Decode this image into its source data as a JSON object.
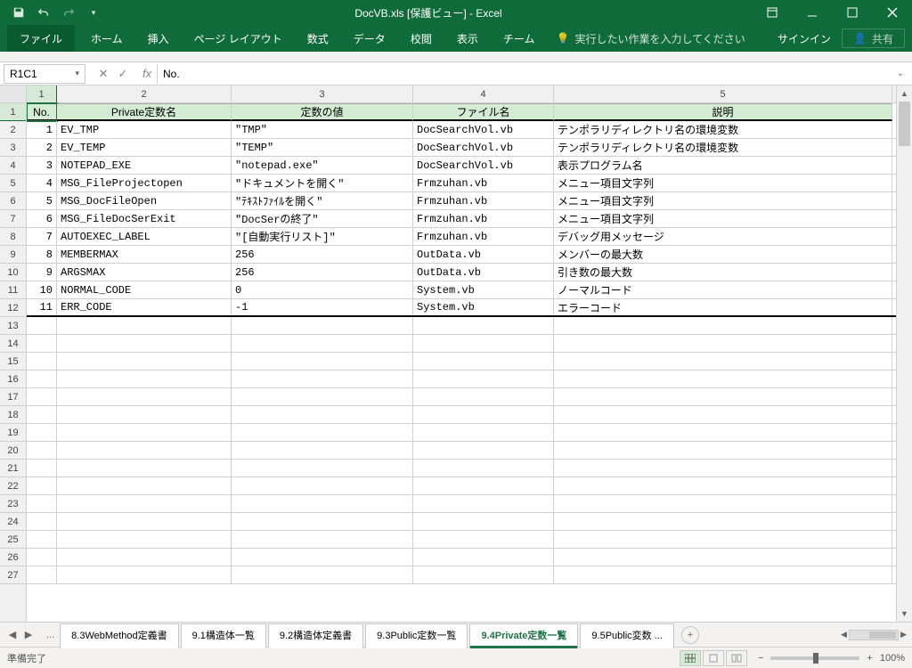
{
  "title": "DocVB.xls  [保護ビュー] - Excel",
  "qat": {
    "save": "save",
    "undo": "undo",
    "redo": "redo"
  },
  "ribbon": {
    "file": "ファイル",
    "tabs": [
      "ホーム",
      "挿入",
      "ページ レイアウト",
      "数式",
      "データ",
      "校閲",
      "表示",
      "チーム"
    ],
    "tell_me": "実行したい作業を入力してください",
    "signin": "サインイン",
    "share": "共有"
  },
  "fx": {
    "namebox": "R1C1",
    "formula": "No."
  },
  "columns": [
    "1",
    "2",
    "3",
    "4",
    "5"
  ],
  "header_row": [
    "No.",
    "Private定数名",
    "定数の値",
    "ファイル名",
    "説明"
  ],
  "rows": [
    {
      "no": "1",
      "name": "EV_TMP",
      "val": "\"TMP\"",
      "file": "DocSearchVol.vb",
      "desc": "テンポラリディレクトリ名の環境変数"
    },
    {
      "no": "2",
      "name": "EV_TEMP",
      "val": "\"TEMP\"",
      "file": "DocSearchVol.vb",
      "desc": "テンポラリディレクトリ名の環境変数"
    },
    {
      "no": "3",
      "name": "NOTEPAD_EXE",
      "val": "\"notepad.exe\"",
      "file": "DocSearchVol.vb",
      "desc": "表示プログラム名"
    },
    {
      "no": "4",
      "name": "MSG_FileProjectopen",
      "val": "\"ドキュメントを開く\"",
      "file": "Frmzuhan.vb",
      "desc": "メニュー項目文字列"
    },
    {
      "no": "5",
      "name": "MSG_DocFileOpen",
      "val": "\"ﾃｷｽﾄﾌｧｲﾙを開く\"",
      "file": "Frmzuhan.vb",
      "desc": "メニュー項目文字列"
    },
    {
      "no": "6",
      "name": "MSG_FileDocSerExit",
      "val": "\"DocSerの終了\"",
      "file": "Frmzuhan.vb",
      "desc": "メニュー項目文字列"
    },
    {
      "no": "7",
      "name": "AUTOEXEC_LABEL",
      "val": "\"[自動実行リスト]\"",
      "file": "Frmzuhan.vb",
      "desc": "デバッグ用メッセージ"
    },
    {
      "no": "8",
      "name": "MEMBERMAX",
      "val": "256",
      "file": "OutData.vb",
      "desc": "メンバーの最大数"
    },
    {
      "no": "9",
      "name": "ARGSMAX",
      "val": "256",
      "file": "OutData.vb",
      "desc": "引き数の最大数"
    },
    {
      "no": "10",
      "name": "NORMAL_CODE",
      "val": "0",
      "file": "System.vb",
      "desc": "ノーマルコード"
    },
    {
      "no": "11",
      "name": "ERR_CODE",
      "val": "-1",
      "file": "System.vb",
      "desc": "エラーコード"
    }
  ],
  "empty_rows": 15,
  "sheet_tabs": {
    "items": [
      "8.3WebMethod定義書",
      "9.1構造体一覧",
      "9.2構造体定義書",
      "9.3Public定数一覧",
      "9.4Private定数一覧",
      "9.5Public変数 ..."
    ],
    "active": 4
  },
  "status": {
    "ready": "準備完了",
    "zoom": "100%"
  }
}
